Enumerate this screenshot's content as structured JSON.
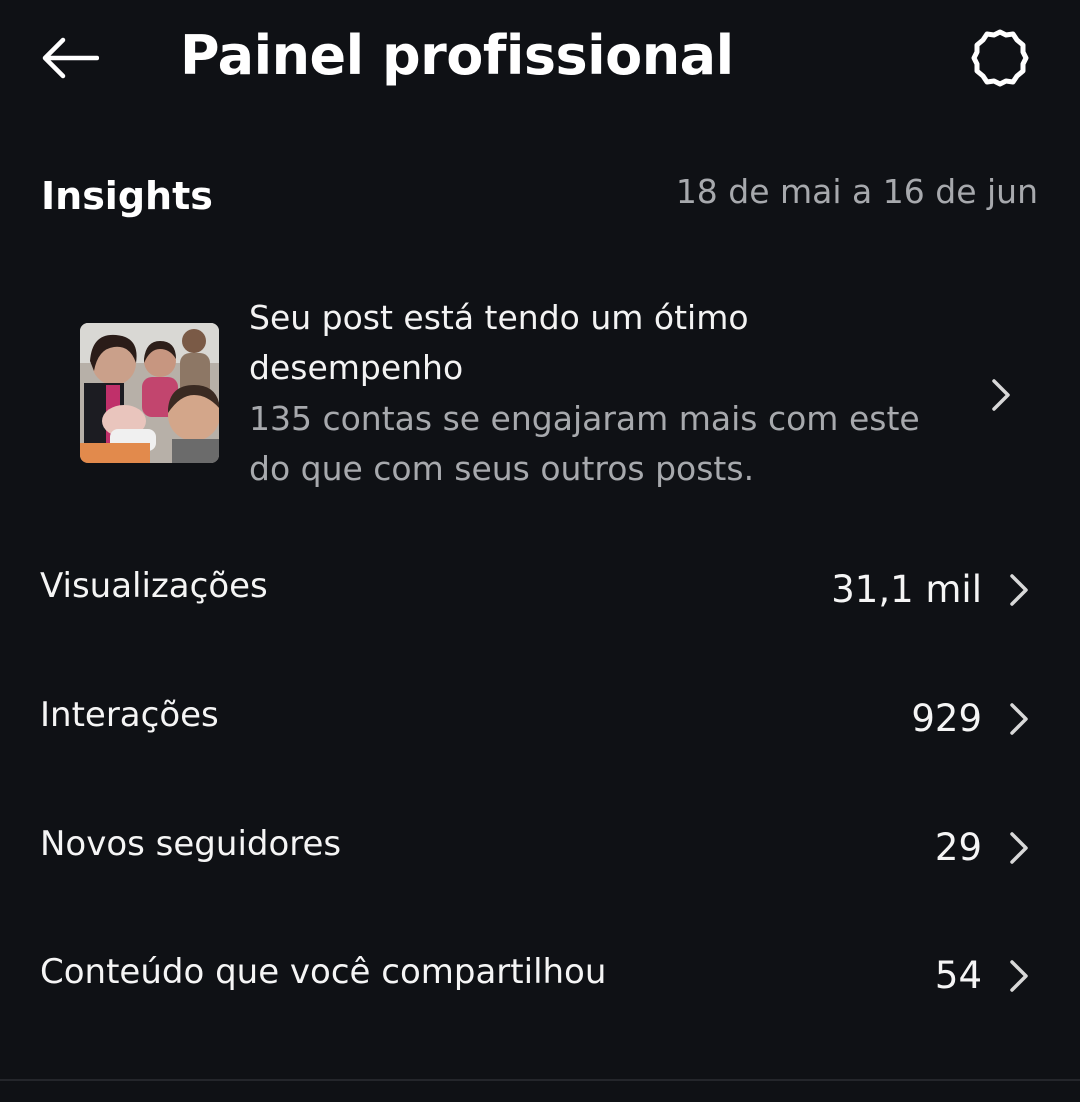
{
  "header": {
    "title": "Painel profissional",
    "back_icon": "arrow-left-icon",
    "settings_icon": "gear-icon"
  },
  "insights": {
    "title": "Insights",
    "date_range": "18 de mai a 16 de jun"
  },
  "highlight": {
    "title": "Seu post está tendo um ótimo desempenho",
    "description": "135 contas se engajaram mais com este do que com seus outros posts.",
    "chevron_icon": "chevron-right-icon"
  },
  "metrics": [
    {
      "label": "Visualizações",
      "value": "31,1 mil"
    },
    {
      "label": "Interações",
      "value": "929"
    },
    {
      "label": "Novos seguidores",
      "value": "29"
    },
    {
      "label": "Conteúdo que você compartilhou",
      "value": "54"
    }
  ],
  "colors": {
    "background": "#0f1115",
    "text_primary": "#f5f5f5",
    "text_secondary": "#a7a9ad"
  }
}
